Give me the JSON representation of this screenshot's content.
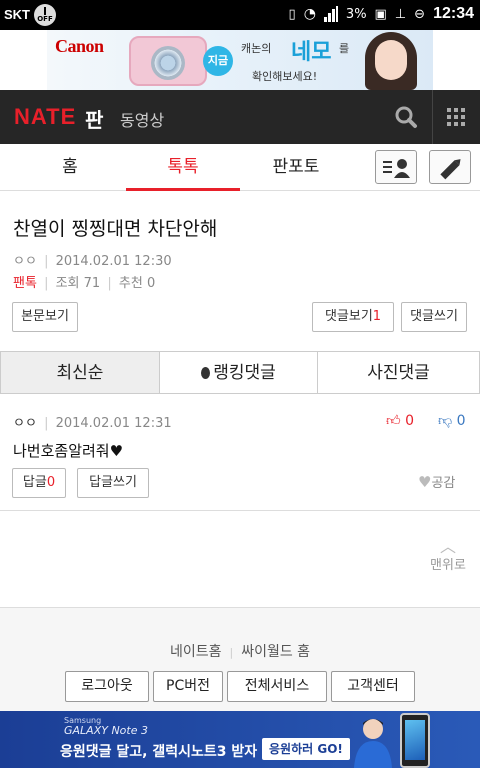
{
  "status_bar": {
    "carrier": "SKT",
    "off_label": "OFF",
    "battery": "3%",
    "time": "12:34"
  },
  "top_ad": {
    "brand": "Canon",
    "bubble": "지금",
    "line1": "캐논의",
    "highlight": "네모",
    "line1_suffix": "를",
    "line2": "확인해보세요!"
  },
  "nav": {
    "logo": "NATE",
    "section": "판",
    "video": "동영상"
  },
  "tabs": [
    {
      "label": "홈",
      "active": false
    },
    {
      "label": "톡톡",
      "active": true
    },
    {
      "label": "판포토",
      "active": false
    }
  ],
  "post": {
    "title": "찬열이 찡찡대면 차단안해",
    "author": "ㅇㅇ",
    "date": "2014.02.01 12:30",
    "category": "팬톡",
    "views_label": "조회",
    "views": "71",
    "recommend_label": "추천",
    "recommend": "0"
  },
  "post_buttons": {
    "view_body": "본문보기",
    "view_comments": "댓글보기",
    "comment_count": "1",
    "write_comment": "댓글쓰기"
  },
  "comment_tabs": [
    {
      "label": "최신순",
      "active": true
    },
    {
      "label": "랭킹댓글",
      "active": false
    },
    {
      "label": "사진댓글",
      "active": false
    }
  ],
  "comment": {
    "author": "ㅇㅇ",
    "date": "2014.02.01 12:31",
    "up": "0",
    "down": "0",
    "text": "나번호좀알려줘♥",
    "reply_label": "답글",
    "reply_count": "0",
    "write_reply": "답글쓰기",
    "like_label": "공감"
  },
  "to_top": "맨위로",
  "footer": {
    "links": [
      "네이트홈",
      "싸이월드 홈"
    ],
    "buttons": [
      "로그아웃",
      "PC버전",
      "전체서비스",
      "고객센터"
    ]
  },
  "bottom_ad": {
    "brand": "Samsung",
    "product": "GALAXY Note 3",
    "message": "응원댓글 달고, 갤럭시노트3 받자",
    "cta": "응원하러 GO!"
  },
  "colors": {
    "accent": "#e8202a",
    "navbar": "#262626",
    "ad_blue": "#1b3e95"
  }
}
